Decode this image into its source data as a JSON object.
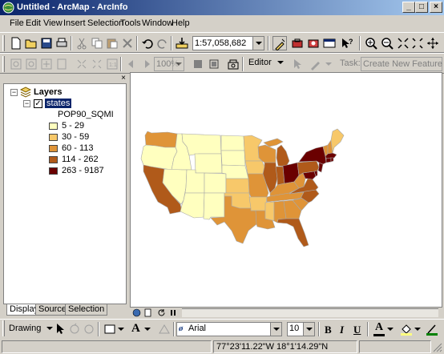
{
  "window": {
    "title": "Untitled - ArcMap - ArcInfo"
  },
  "menu": [
    "File",
    "Edit",
    "View",
    "Insert",
    "Selection",
    "Tools",
    "Window",
    "Help"
  ],
  "standard_toolbar": {
    "scale_value": "1:57,058,682",
    "icons": [
      "new-icon",
      "open-icon",
      "save-icon",
      "print-icon",
      "cut-icon",
      "copy-icon",
      "paste-icon",
      "delete-icon",
      "undo-icon",
      "redo-icon",
      "add-data-icon",
      "editor-toolbar-icon",
      "arctoolbox-icon",
      "arccatalog-icon",
      "command-line-icon",
      "whats-this-icon",
      "zoom-in-icon",
      "zoom-out-icon",
      "fixed-zoom-in-icon",
      "fixed-zoom-out-icon",
      "pan-icon",
      "full-extent-icon"
    ]
  },
  "layout_toolbar": {
    "zoom_value": "100%"
  },
  "editor_toolbar": {
    "editor_label": "Editor",
    "task_label": "Task:",
    "task_value": "Create New Feature"
  },
  "toc": {
    "root_label": "Layers",
    "layer_label": "states",
    "field_label": "POP90_SQMI",
    "classes": [
      {
        "label": "5 - 29",
        "color": "#ffffbf"
      },
      {
        "label": "30 - 59",
        "color": "#f7c86a"
      },
      {
        "label": "60 - 113",
        "color": "#df9438"
      },
      {
        "label": "114 - 262",
        "color": "#b05a1a"
      },
      {
        "label": "263 - 9187",
        "color": "#6a0000"
      }
    ],
    "tabs": [
      "Display",
      "Source",
      "Selection"
    ]
  },
  "drawing_toolbar": {
    "drawing_label": "Drawing",
    "font_name": "Arial",
    "font_size": "10",
    "bold": "B",
    "italic": "I",
    "underline": "U",
    "font_color_glyph": "A"
  },
  "status": {
    "coordinates": "77°23'11.22\"W  18°1'14.29\"N"
  }
}
